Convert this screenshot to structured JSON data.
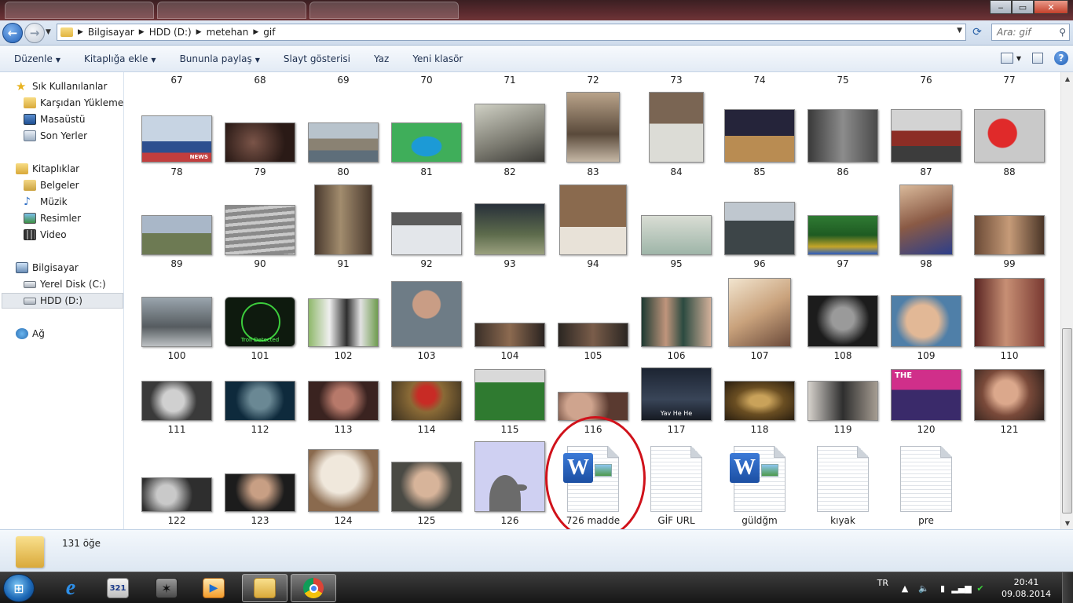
{
  "window": {
    "minimize": "‒",
    "maximize": "▭",
    "close": "✕"
  },
  "address": {
    "crumbs": [
      "Bilgisayar",
      "HDD (D:)",
      "metehan",
      "gif"
    ],
    "search_placeholder": "Ara: gif"
  },
  "toolbar": {
    "organize": "Düzenle",
    "add_library": "Kitaplığa ekle",
    "share": "Bununla paylaş",
    "slideshow": "Slayt gösterisi",
    "print": "Yaz",
    "new_folder": "Yeni klasör",
    "help": "?"
  },
  "sidebar": {
    "favorites": "Sık Kullanılanlar",
    "downloads": "Karşıdan Yüklemeler",
    "desktop": "Masaüstü",
    "recent": "Son Yerler",
    "libraries": "Kitaplıklar",
    "documents": "Belgeler",
    "music": "Müzik",
    "pictures": "Resimler",
    "videos": "Video",
    "computer": "Bilgisayar",
    "local_disk": "Yerel Disk (C:)",
    "hdd": "HDD (D:)",
    "network": "Ağ"
  },
  "files": {
    "row0": [
      "67",
      "68",
      "69",
      "70",
      "71",
      "72",
      "73",
      "74",
      "75",
      "76",
      "77"
    ],
    "row1": [
      "78",
      "79",
      "80",
      "81",
      "82",
      "83",
      "84",
      "85",
      "86",
      "87",
      "88"
    ],
    "row2": [
      "89",
      "90",
      "91",
      "92",
      "93",
      "94",
      "95",
      "96",
      "97",
      "98",
      "99"
    ],
    "row3": [
      "100",
      "101",
      "102",
      "103",
      "104",
      "105",
      "106",
      "107",
      "108",
      "109",
      "110"
    ],
    "row4": [
      "111",
      "112",
      "113",
      "114",
      "115",
      "116",
      "117",
      "118",
      "119",
      "120",
      "121"
    ],
    "row5": [
      "122",
      "123",
      "124",
      "125",
      "126",
      "726 madde",
      "GİF URL",
      "güldğm",
      "kıyak",
      "pre"
    ]
  },
  "thumb_text": {
    "news": "NEWS",
    "troll": "Troll Detected",
    "yav": "Yav He He",
    "show": "THE"
  },
  "status": {
    "item_count": "131 öğe"
  },
  "taskbar": {
    "app_321": "321",
    "language": "TR",
    "time": "20:41",
    "date": "09.08.2014"
  }
}
